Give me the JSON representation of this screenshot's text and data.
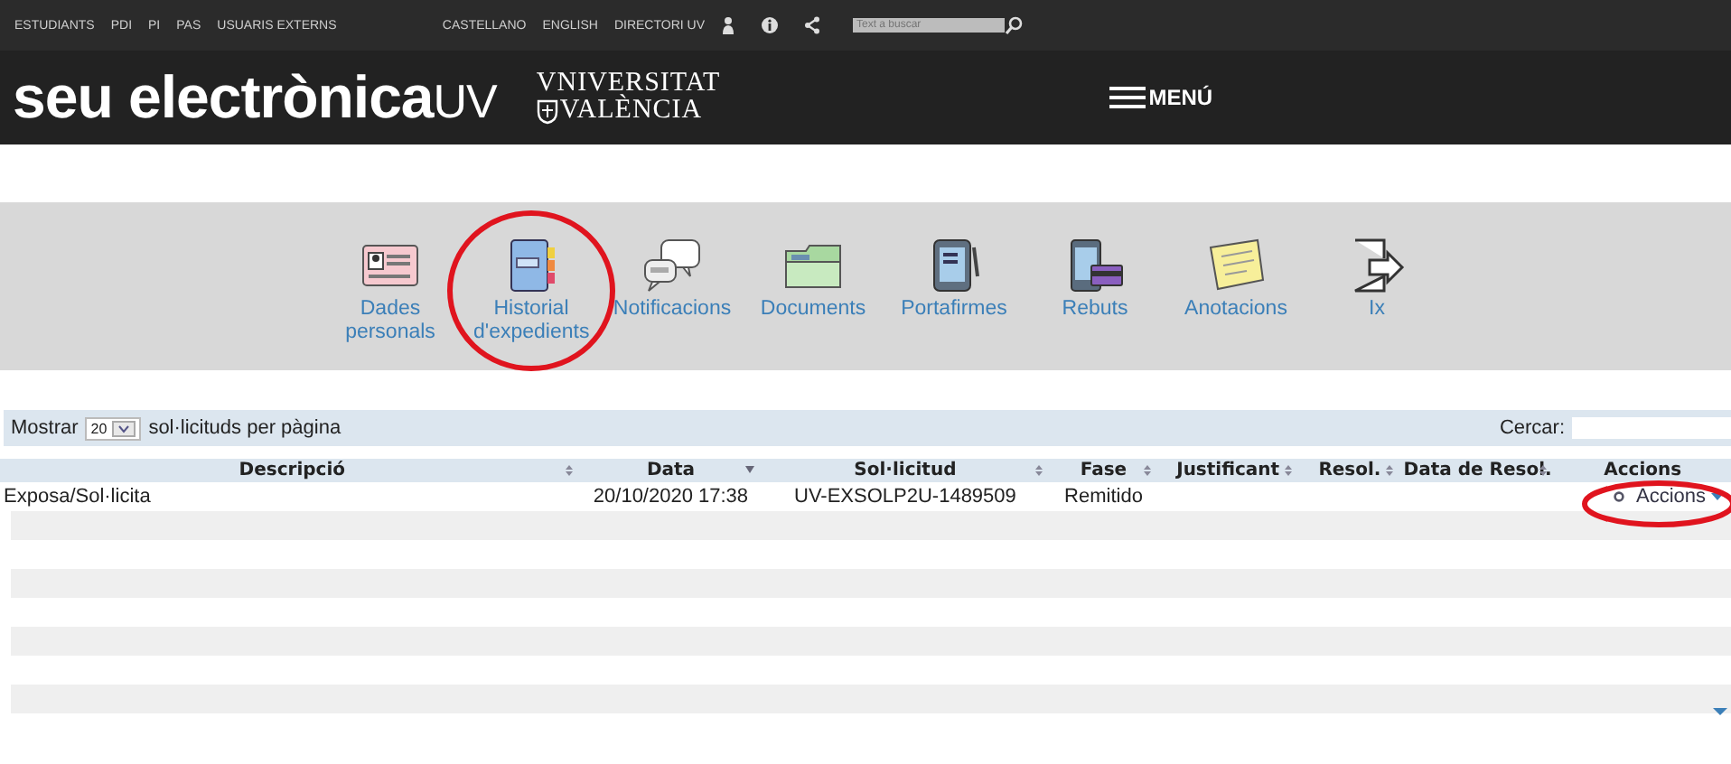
{
  "top_bar": {
    "audience_links": [
      "ESTUDIANTS",
      "PDI",
      "PI",
      "PAS",
      "USUARIS EXTERNS"
    ],
    "language_links": [
      "CASTELLANO",
      "ENGLISH",
      "DIRECTORI UV"
    ],
    "search": {
      "placeholder": "Text a buscar"
    }
  },
  "header": {
    "logo": "seu electrònica",
    "logo_suffix": "UV",
    "university_line_1": "VNIVERSITAT",
    "university_line_2": "VALÈNCIA",
    "menu": "MENÚ"
  },
  "nav": [
    {
      "kind": "card",
      "label": "Dades personals",
      "circled": false
    },
    {
      "kind": "notebook",
      "label": "Historial d'expedients",
      "circled": true
    },
    {
      "kind": "chat",
      "label": "Notificacions",
      "circled": false
    },
    {
      "kind": "folder",
      "label": "Documents",
      "circled": false
    },
    {
      "kind": "tablet",
      "label": "Portafirmes",
      "circled": false
    },
    {
      "kind": "receipt",
      "label": "Rebuts",
      "circled": false
    },
    {
      "kind": "note",
      "label": "Anotacions",
      "circled": false
    },
    {
      "kind": "exit",
      "label": "Ix",
      "circled": false
    }
  ],
  "table_controls": {
    "show_label": "Mostrar",
    "page_size": "20",
    "per_page_label": "sol·licituds per pàgina",
    "search_label": "Cercar:"
  },
  "table": {
    "columns": [
      {
        "label": "Descripció",
        "sortable": true,
        "sorted_desc": false
      },
      {
        "label": "Data",
        "sortable": true,
        "sorted_desc": true
      },
      {
        "label": "Sol·licitud",
        "sortable": true,
        "sorted_desc": false
      },
      {
        "label": "Fase",
        "sortable": true,
        "sorted_desc": false
      },
      {
        "label": "Justificant",
        "sortable": true,
        "sorted_desc": false
      },
      {
        "label": "Resol.",
        "sortable": true,
        "sorted_desc": false
      },
      {
        "label": "Data de Resol.",
        "sortable": true,
        "sorted_desc": false
      },
      {
        "label": "Accions",
        "sortable": false
      }
    ],
    "rows": [
      {
        "cells": [
          "Exposa/Sol·licita",
          "20/10/2020 17:38",
          "UV-EXSOLP2U-1489509",
          "Remitido",
          "",
          "",
          ""
        ],
        "action": "Accions",
        "actions_circled": true
      }
    ]
  }
}
